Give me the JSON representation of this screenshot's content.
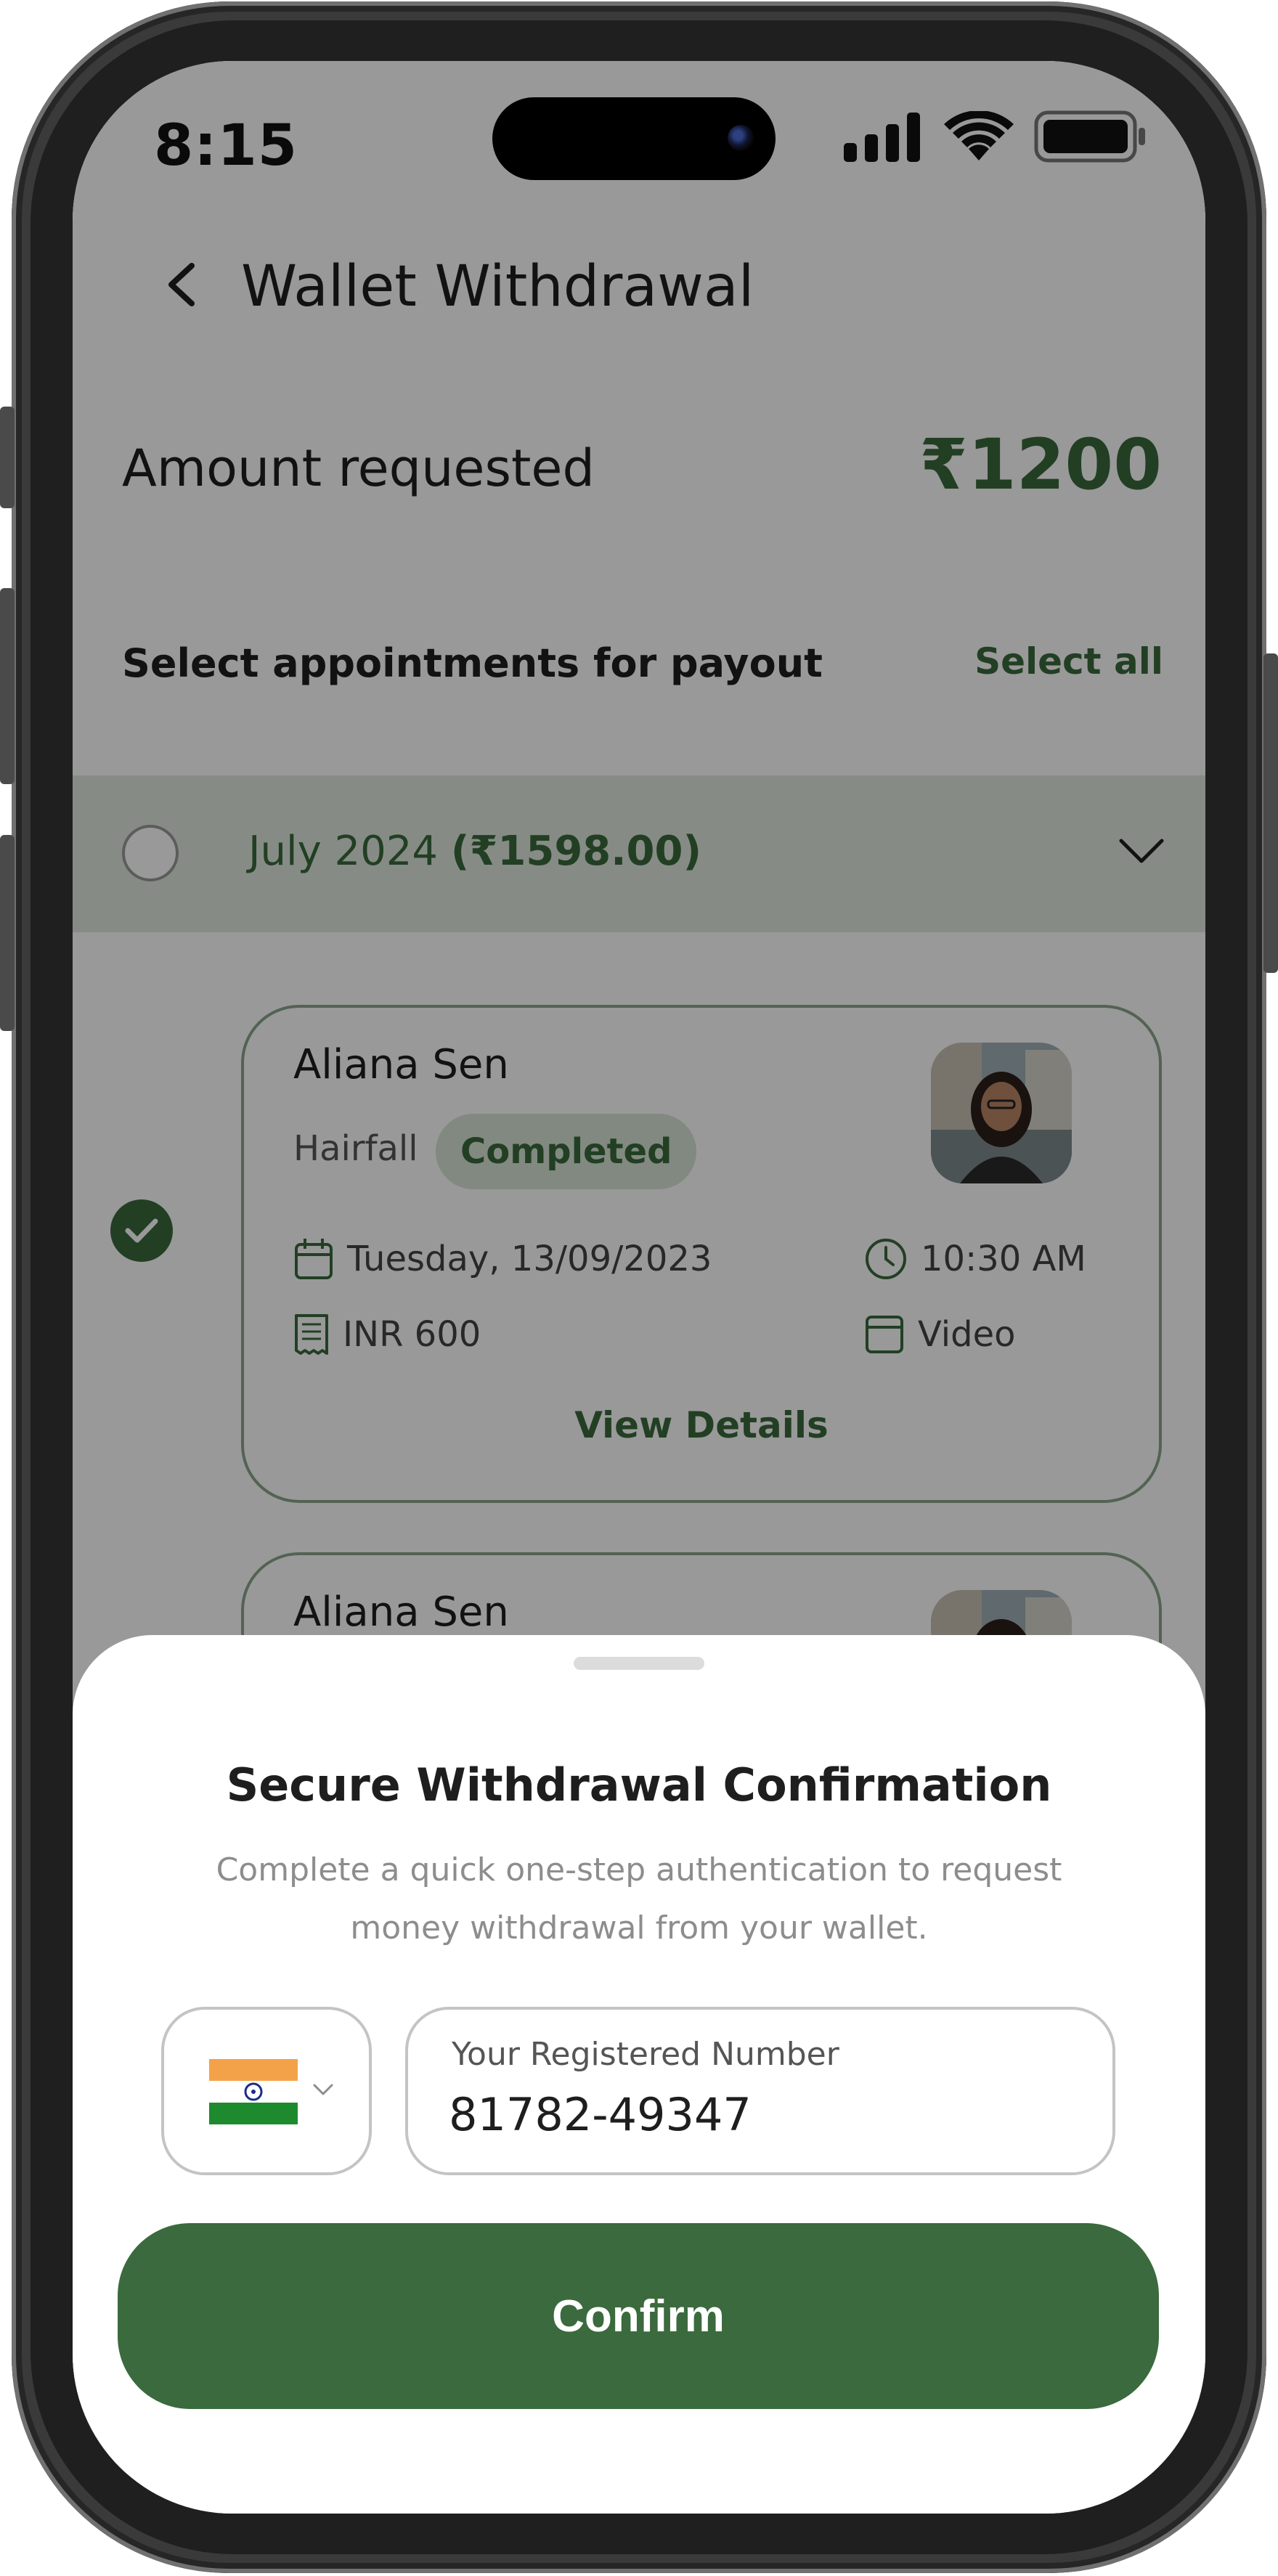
{
  "status_bar": {
    "time": "8:15"
  },
  "header": {
    "title": "Wallet Withdrawal"
  },
  "amount": {
    "label": "Amount requested",
    "value": "₹1200"
  },
  "selection": {
    "label": "Select appointments for payout",
    "select_all": "Select all"
  },
  "month_group": {
    "label": "July 2024",
    "total": "(₹1598.00)"
  },
  "appointments": [
    {
      "name": "Aliana Sen",
      "service": "Hairfall",
      "status": "Completed",
      "date": "Tuesday, 13/09/2023",
      "time": "10:30 AM",
      "fee": "INR 600",
      "mode": "Video",
      "action": "View Details"
    },
    {
      "name": "Aliana Sen"
    }
  ],
  "sheet": {
    "title": "Secure Withdrawal Confirmation",
    "subtitle": "Complete a quick one-step authentication to request money withdrawal from your wallet.",
    "phone_label": "Your Registered Number",
    "phone_value": "81782-49347",
    "confirm_label": "Confirm"
  },
  "colors": {
    "accent": "#3a6a3d",
    "badge_bg": "#d8e5d6",
    "month_bg": "#dfe9de"
  }
}
